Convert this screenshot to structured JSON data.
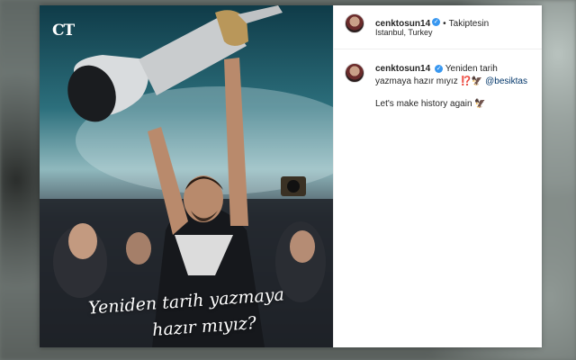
{
  "post": {
    "username": "cenktosun14",
    "follow_status": "Takiptesin",
    "location": "Istanbul, Turkey",
    "verified_icon": "verified-badge-icon"
  },
  "photo": {
    "brand_mark": "CT",
    "overlay_line1": "Yeniden tarih yazmaya",
    "overlay_line2": "hazır mıyız?"
  },
  "caption": {
    "username": "cenktosun14",
    "text": "Yeniden tarih yazmaya hazır mıyız ⁉️🦅",
    "mention": "@besiktas",
    "translation": "Let's make history again 🦅"
  },
  "colors": {
    "verified": "#3897f0",
    "mention": "#003569",
    "text": "#262626"
  }
}
